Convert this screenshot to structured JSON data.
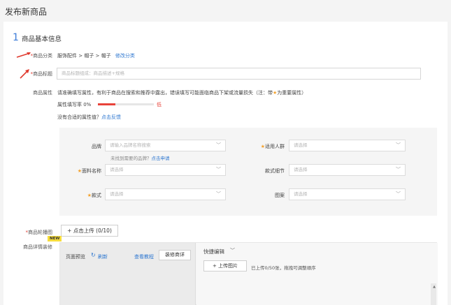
{
  "page_title": "发布新商品",
  "section": {
    "number": "1",
    "title": "商品基本信息"
  },
  "category": {
    "label": "商品分类",
    "value": "服饰配件 > 帽子 > 帽子",
    "edit_link": "修改分类"
  },
  "product_title": {
    "label": "商品标题",
    "placeholder": "商品标题组成：商品描述+规格"
  },
  "attributes": {
    "label": "商品属性",
    "notice_prefix": "请准确填写属性，有利于商品在搜索和推荐中露出，错误填写可能面临商品下架或流量损失",
    "notice_note_open": "（注：带",
    "notice_note_close": "为重要属性）",
    "fill_rate_label": "属性填写率 0%",
    "fill_rate_value": 0,
    "fill_rate_level": "低",
    "missing_prompt": "没有合适的属性值？",
    "missing_link": "点击反馈",
    "fields": {
      "brand": {
        "label": "品牌",
        "placeholder": "请输入品牌名称搜索"
      },
      "brand_hint": "未找到需要的品牌？",
      "brand_hint_link": "点击申请",
      "audience": {
        "label": "适用人群",
        "placeholder": "请选择"
      },
      "fabric": {
        "label": "面料名称",
        "placeholder": "请选择"
      },
      "detail": {
        "label": "款式细节",
        "placeholder": "请选择"
      },
      "style": {
        "label": "款式",
        "placeholder": "请选择"
      },
      "pattern": {
        "label": "图案",
        "placeholder": "请选择"
      }
    }
  },
  "main_images": {
    "label": "商品轮播图",
    "upload_button": "+ 点击上传 (0/10)"
  },
  "detail_editor": {
    "label": "商品详情装修",
    "badge": "NEW",
    "preview_label": "页面预览",
    "refresh_label": "刷新",
    "tutorial_link": "查看教程",
    "decorate_button": "装修商详",
    "quick_edit_label": "快捷编辑",
    "upload_image_button": "+ 上传图片",
    "upload_hint": "已上传0/50张，拖拽可调整顺序"
  },
  "colors": {
    "accent": "#2e77d0",
    "required": "#e03a2f",
    "important": "#f4a22d",
    "bar_fill": "#e8433a",
    "badge": "#f6dc3b"
  }
}
